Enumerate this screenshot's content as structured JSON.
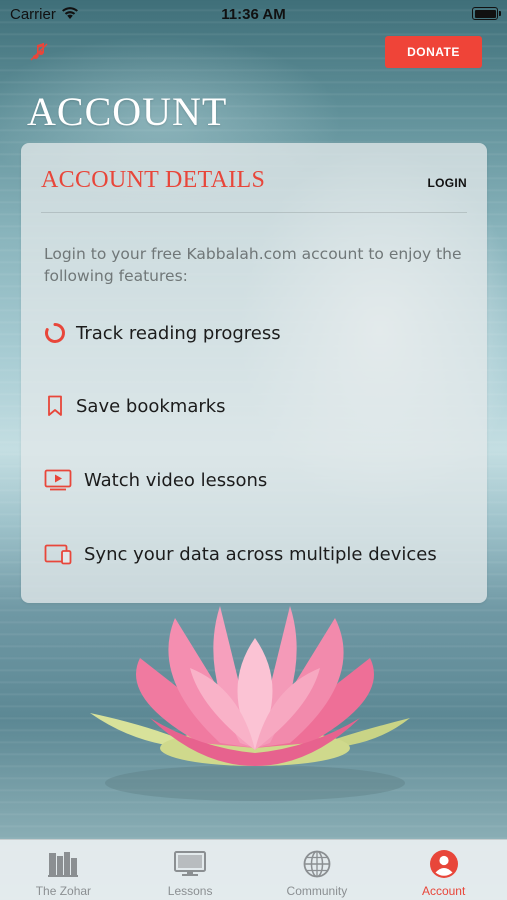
{
  "status_bar": {
    "carrier": "Carrier",
    "time": "11:36 AM"
  },
  "header": {
    "donate_label": "DONATE",
    "title": "ACCOUNT"
  },
  "card": {
    "title": "ACCOUNT DETAILS",
    "login_label": "LOGIN",
    "intro": "Login to your free Kabbalah.com account to enjoy the following features:",
    "features": [
      {
        "label": "Track reading progress",
        "icon": "progress-ring-icon"
      },
      {
        "label": "Save bookmarks",
        "icon": "bookmark-icon"
      },
      {
        "label": "Watch video lessons",
        "icon": "video-icon"
      },
      {
        "label": "Sync your data across multiple devices",
        "icon": "devices-icon"
      }
    ]
  },
  "tabs": [
    {
      "label": "The Zohar",
      "icon": "books-icon",
      "active": false
    },
    {
      "label": "Lessons",
      "icon": "monitor-icon",
      "active": false
    },
    {
      "label": "Community",
      "icon": "globe-icon",
      "active": false
    },
    {
      "label": "Account",
      "icon": "user-icon",
      "active": true
    }
  ],
  "colors": {
    "accent": "#e8463a",
    "donate_bg": "#ef4438",
    "inactive_tab": "#8b8f92"
  }
}
